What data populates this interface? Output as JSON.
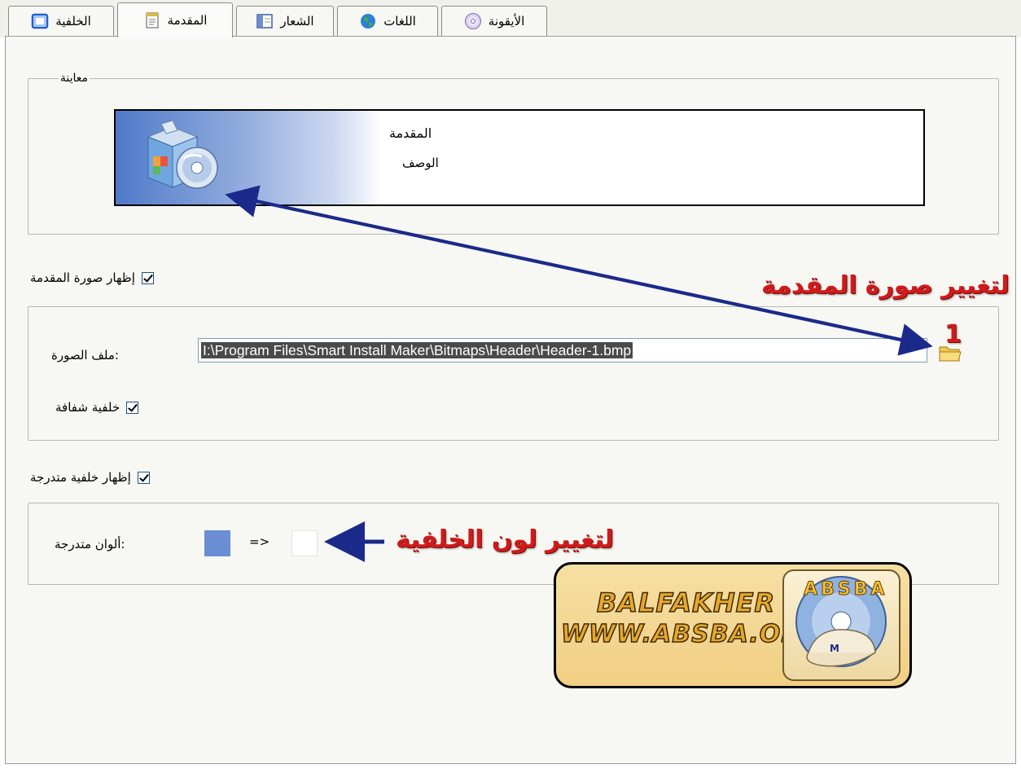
{
  "tabs": [
    {
      "label": "الخلفية",
      "icon": "window-icon",
      "active": false
    },
    {
      "label": "المقدمة",
      "icon": "notepad-icon",
      "active": true
    },
    {
      "label": "الشعار",
      "icon": "panel-icon",
      "active": false
    },
    {
      "label": "اللغات",
      "icon": "globe-icon",
      "active": false
    },
    {
      "label": "الأيقونة",
      "icon": "cd-icon",
      "active": false
    }
  ],
  "preview": {
    "legend": "معاينة",
    "title": "المقدمة",
    "description": "الوصف"
  },
  "header_image": {
    "show_label": "إظهار صورة المقدمة",
    "show_checked": true,
    "file_label": ":ملف الصورة",
    "file_value": "I:\\Program Files\\Smart Install Maker\\Bitmaps\\Header\\Header-1.bmp",
    "transparent_label": "خلفية شفافة",
    "transparent_checked": true
  },
  "gradient": {
    "show_label": "إظهار خلفية متدرجة",
    "show_checked": true,
    "colors_label": ":ألوان متدرجة",
    "arrow": "=>",
    "color_from": "#6a8ed3",
    "color_to": "#ffffff"
  },
  "annotations": {
    "change_header_image": "لتغيير صورة المقدمة",
    "marker_number": "1",
    "change_background_color": "لتغيير لون الخلفية"
  },
  "logo": {
    "line1": "BALFAKHER",
    "line2": "WWW.ABSBA.ORG",
    "badge_letters": "ABSBA",
    "cap_letter": "M"
  },
  "colors": {
    "annotation_red": "#d11a1a",
    "arrow_navy": "#1b2a8a",
    "accent_blue": "#4f7ac9"
  }
}
